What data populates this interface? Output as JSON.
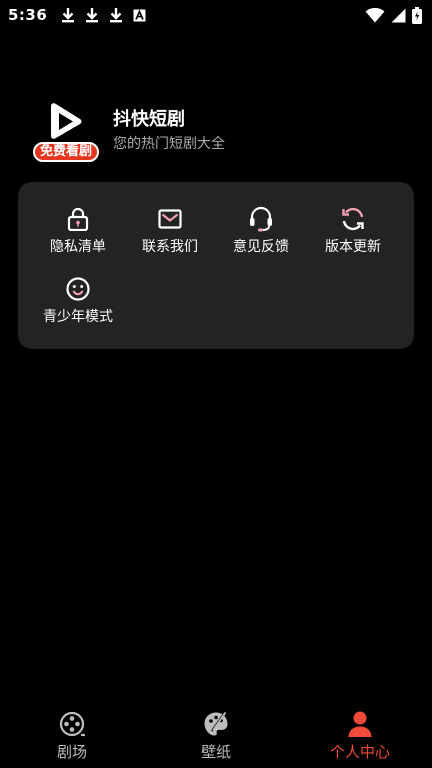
{
  "status_bar": {
    "time": "5:36",
    "left_icons": [
      "download-icon",
      "download-icon",
      "download-icon",
      "font-a-icon"
    ],
    "right_icons": [
      "wifi-icon",
      "signal-icon",
      "battery-icon"
    ]
  },
  "profile": {
    "logo_badge": "免费看剧",
    "app_name": "抖快短剧",
    "tagline": "您的热门短剧大全"
  },
  "functions": [
    {
      "label": "隐私清单",
      "icon": "lock-icon"
    },
    {
      "label": "联系我们",
      "icon": "mail-icon"
    },
    {
      "label": "意见反馈",
      "icon": "headset-icon"
    },
    {
      "label": "版本更新",
      "icon": "refresh-icon"
    },
    {
      "label": "青少年模式",
      "icon": "smiley-icon"
    }
  ],
  "bottom_nav": {
    "items": [
      {
        "label": "剧场",
        "icon": "film-reel-icon",
        "active": false
      },
      {
        "label": "壁纸",
        "icon": "palette-icon",
        "active": false
      },
      {
        "label": "个人中心",
        "icon": "person-icon",
        "active": true
      }
    ]
  },
  "colors": {
    "accent": "#f04a3a",
    "card_bg": "#232323",
    "badge_red": "#e8371f",
    "icon_pink": "#f0a0b0"
  }
}
